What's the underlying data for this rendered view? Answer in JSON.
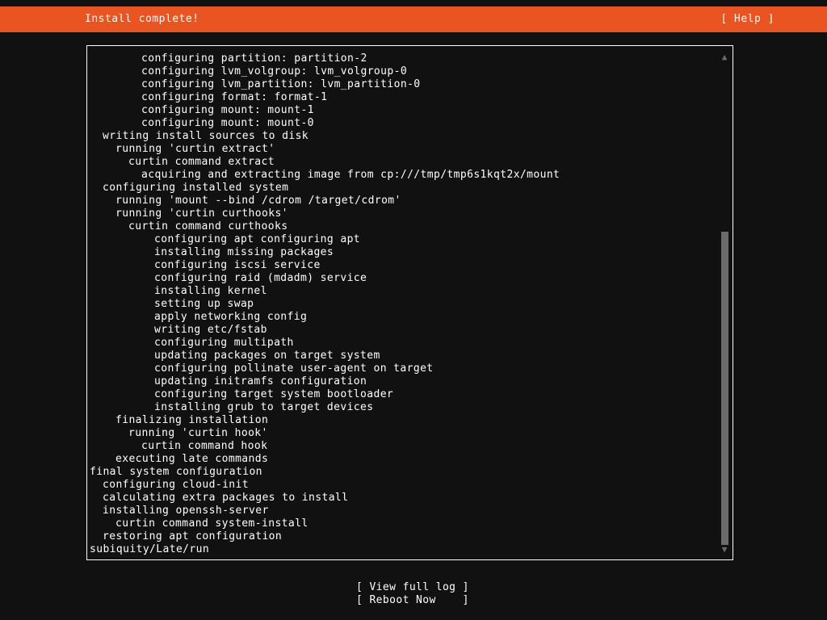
{
  "header": {
    "title": "Install complete!",
    "help_label": "[ Help ]"
  },
  "log": {
    "lines": [
      {
        "indent": 4,
        "text": "configuring partition: partition-2"
      },
      {
        "indent": 4,
        "text": "configuring lvm_volgroup: lvm_volgroup-0"
      },
      {
        "indent": 4,
        "text": "configuring lvm_partition: lvm_partition-0"
      },
      {
        "indent": 4,
        "text": "configuring format: format-1"
      },
      {
        "indent": 4,
        "text": "configuring mount: mount-1"
      },
      {
        "indent": 4,
        "text": "configuring mount: mount-0"
      },
      {
        "indent": 1,
        "text": "writing install sources to disk"
      },
      {
        "indent": 2,
        "text": "running 'curtin extract'"
      },
      {
        "indent": 3,
        "text": "curtin command extract"
      },
      {
        "indent": 4,
        "text": "acquiring and extracting image from cp:///tmp/tmp6s1kqt2x/mount"
      },
      {
        "indent": 1,
        "text": "configuring installed system"
      },
      {
        "indent": 2,
        "text": "running 'mount --bind /cdrom /target/cdrom'"
      },
      {
        "indent": 2,
        "text": "running 'curtin curthooks'"
      },
      {
        "indent": 3,
        "text": "curtin command curthooks"
      },
      {
        "indent": 5,
        "text": "configuring apt configuring apt"
      },
      {
        "indent": 5,
        "text": "installing missing packages"
      },
      {
        "indent": 5,
        "text": "configuring iscsi service"
      },
      {
        "indent": 5,
        "text": "configuring raid (mdadm) service"
      },
      {
        "indent": 5,
        "text": "installing kernel"
      },
      {
        "indent": 5,
        "text": "setting up swap"
      },
      {
        "indent": 5,
        "text": "apply networking config"
      },
      {
        "indent": 5,
        "text": "writing etc/fstab"
      },
      {
        "indent": 5,
        "text": "configuring multipath"
      },
      {
        "indent": 5,
        "text": "updating packages on target system"
      },
      {
        "indent": 5,
        "text": "configuring pollinate user-agent on target"
      },
      {
        "indent": 5,
        "text": "updating initramfs configuration"
      },
      {
        "indent": 5,
        "text": "configuring target system bootloader"
      },
      {
        "indent": 5,
        "text": "installing grub to target devices"
      },
      {
        "indent": 2,
        "text": "finalizing installation"
      },
      {
        "indent": 3,
        "text": "running 'curtin hook'"
      },
      {
        "indent": 4,
        "text": "curtin command hook"
      },
      {
        "indent": 2,
        "text": "executing late commands"
      },
      {
        "indent": 0,
        "text": "final system configuration"
      },
      {
        "indent": 1,
        "text": "configuring cloud-init"
      },
      {
        "indent": 1,
        "text": "calculating extra packages to install"
      },
      {
        "indent": 1,
        "text": "installing openssh-server"
      },
      {
        "indent": 2,
        "text": "curtin command system-install"
      },
      {
        "indent": 1,
        "text": "restoring apt configuration"
      },
      {
        "indent": 0,
        "text": "subiquity/Late/run"
      }
    ],
    "scrollbar": {
      "up_arrow": "▲",
      "down_arrow": "▼"
    }
  },
  "footer": {
    "buttons": [
      {
        "label": "[ View full log ]"
      },
      {
        "label": "[ Reboot Now    ]"
      }
    ]
  },
  "colors": {
    "accent": "#E95420",
    "background": "#111111",
    "text": "#FFFFFF",
    "scrollbar_thumb": "#6B6B6B"
  }
}
